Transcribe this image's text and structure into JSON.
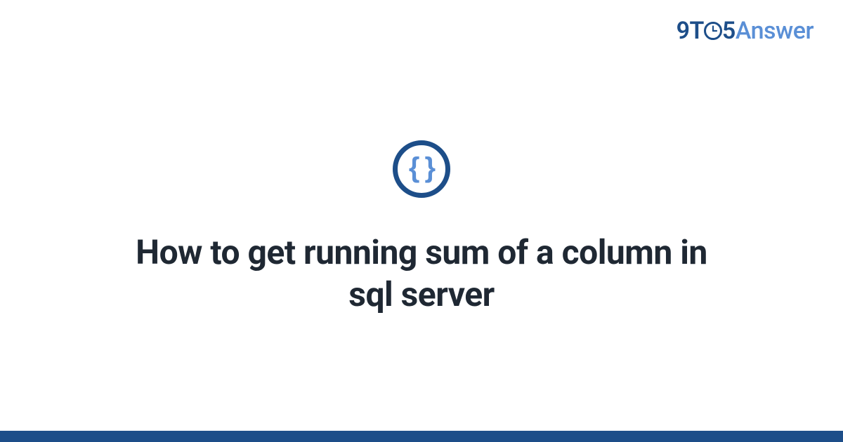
{
  "logo": {
    "nine": "9",
    "t": "T",
    "five": "5",
    "answer": "Answer"
  },
  "icon": {
    "braces": "{ }"
  },
  "headline": "How to get running sum of a column in sql server",
  "colors": {
    "primary": "#1d4e89",
    "accent": "#5a8fd6",
    "text": "#1f2833"
  }
}
